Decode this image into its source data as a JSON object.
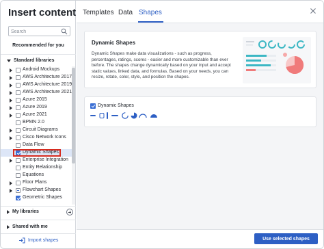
{
  "dialog": {
    "title": "Insert content"
  },
  "search": {
    "placeholder": "Search"
  },
  "left": {
    "recommended": "Recommended for you",
    "standard_libraries": "Standard libraries",
    "my_libraries": "My libraries",
    "shared_with_me": "Shared with me",
    "import_shapes": "Import shapes"
  },
  "libraries": [
    {
      "label": "Android Mockups",
      "expandable": true,
      "checked": false
    },
    {
      "label": "AWS Architecture 2017",
      "expandable": true,
      "checked": false
    },
    {
      "label": "AWS Architecture 2019",
      "expandable": true,
      "checked": false
    },
    {
      "label": "AWS Architecture 2021",
      "expandable": true,
      "checked": false
    },
    {
      "label": "Azure 2015",
      "expandable": true,
      "checked": false
    },
    {
      "label": "Azure 2019",
      "expandable": true,
      "checked": false
    },
    {
      "label": "Azure 2021",
      "expandable": true,
      "checked": false
    },
    {
      "label": "BPMN 2.0",
      "expandable": false,
      "checked": false
    },
    {
      "label": "Circuit Diagrams",
      "expandable": true,
      "checked": false
    },
    {
      "label": "Cisco Network Icons",
      "expandable": true,
      "checked": false
    },
    {
      "label": "Data Flow",
      "expandable": false,
      "checked": false
    },
    {
      "label": "Dynamic Shapes",
      "expandable": false,
      "checked": true,
      "selected": true
    },
    {
      "label": "Enterprise Integration",
      "expandable": true,
      "checked": false
    },
    {
      "label": "Entity Relationship",
      "expandable": false,
      "checked": false
    },
    {
      "label": "Equations",
      "expandable": false,
      "checked": false
    },
    {
      "label": "Floor Plans",
      "expandable": true,
      "checked": false
    },
    {
      "label": "Flowchart Shapes",
      "expandable": true,
      "checked": "partial"
    },
    {
      "label": "Geometric Shapes",
      "expandable": false,
      "checked": true
    }
  ],
  "tabs": [
    {
      "label": "Templates",
      "active": false
    },
    {
      "label": "Data",
      "active": false
    },
    {
      "label": "Shapes",
      "active": true
    }
  ],
  "detail": {
    "title": "Dynamic Shapes",
    "description": "Dynamic Shapes make data visualizations - such as progress, percentages, ratings, scores - easier and more customizable than ever before. The shapes change dynamically based on your input and accept static values, linked data, and formulas. Based on your needs, you can resize, rotate, color, style, and position the shapes."
  },
  "selected_library": {
    "label": "Dynamic Shapes",
    "checked": true
  },
  "footer": {
    "use_button": "Use selected shapes"
  },
  "colors": {
    "accent": "#2d5fc4",
    "checkbox": "#3b6fd4",
    "highlight_border": "#d62b1f",
    "selected_row": "#dde6f7",
    "teal": "#3bb7c4",
    "coral": "#f07b7b"
  },
  "icons": [
    "search-icon",
    "close-icon",
    "chevron-down-icon",
    "chevron-right-icon",
    "plus-icon",
    "import-icon"
  ]
}
